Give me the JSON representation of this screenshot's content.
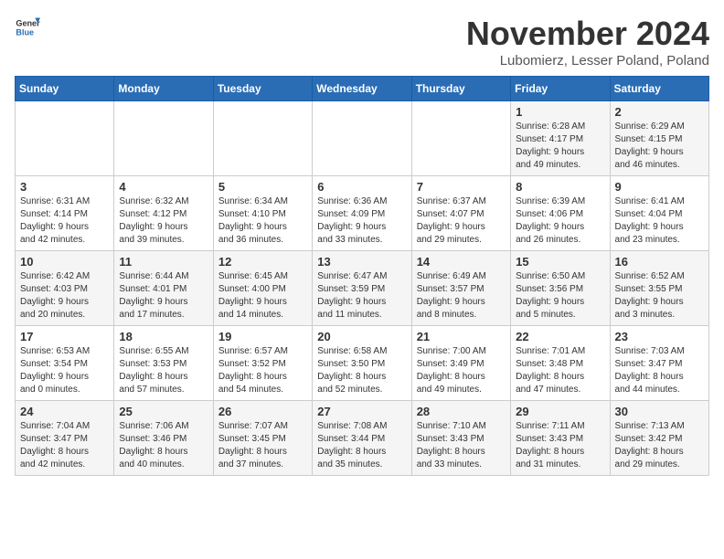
{
  "header": {
    "logo_general": "General",
    "logo_blue": "Blue",
    "month_title": "November 2024",
    "subtitle": "Lubomierz, Lesser Poland, Poland"
  },
  "weekdays": [
    "Sunday",
    "Monday",
    "Tuesday",
    "Wednesday",
    "Thursday",
    "Friday",
    "Saturday"
  ],
  "weeks": [
    [
      {
        "day": "",
        "info": ""
      },
      {
        "day": "",
        "info": ""
      },
      {
        "day": "",
        "info": ""
      },
      {
        "day": "",
        "info": ""
      },
      {
        "day": "",
        "info": ""
      },
      {
        "day": "1",
        "info": "Sunrise: 6:28 AM\nSunset: 4:17 PM\nDaylight: 9 hours\nand 49 minutes."
      },
      {
        "day": "2",
        "info": "Sunrise: 6:29 AM\nSunset: 4:15 PM\nDaylight: 9 hours\nand 46 minutes."
      }
    ],
    [
      {
        "day": "3",
        "info": "Sunrise: 6:31 AM\nSunset: 4:14 PM\nDaylight: 9 hours\nand 42 minutes."
      },
      {
        "day": "4",
        "info": "Sunrise: 6:32 AM\nSunset: 4:12 PM\nDaylight: 9 hours\nand 39 minutes."
      },
      {
        "day": "5",
        "info": "Sunrise: 6:34 AM\nSunset: 4:10 PM\nDaylight: 9 hours\nand 36 minutes."
      },
      {
        "day": "6",
        "info": "Sunrise: 6:36 AM\nSunset: 4:09 PM\nDaylight: 9 hours\nand 33 minutes."
      },
      {
        "day": "7",
        "info": "Sunrise: 6:37 AM\nSunset: 4:07 PM\nDaylight: 9 hours\nand 29 minutes."
      },
      {
        "day": "8",
        "info": "Sunrise: 6:39 AM\nSunset: 4:06 PM\nDaylight: 9 hours\nand 26 minutes."
      },
      {
        "day": "9",
        "info": "Sunrise: 6:41 AM\nSunset: 4:04 PM\nDaylight: 9 hours\nand 23 minutes."
      }
    ],
    [
      {
        "day": "10",
        "info": "Sunrise: 6:42 AM\nSunset: 4:03 PM\nDaylight: 9 hours\nand 20 minutes."
      },
      {
        "day": "11",
        "info": "Sunrise: 6:44 AM\nSunset: 4:01 PM\nDaylight: 9 hours\nand 17 minutes."
      },
      {
        "day": "12",
        "info": "Sunrise: 6:45 AM\nSunset: 4:00 PM\nDaylight: 9 hours\nand 14 minutes."
      },
      {
        "day": "13",
        "info": "Sunrise: 6:47 AM\nSunset: 3:59 PM\nDaylight: 9 hours\nand 11 minutes."
      },
      {
        "day": "14",
        "info": "Sunrise: 6:49 AM\nSunset: 3:57 PM\nDaylight: 9 hours\nand 8 minutes."
      },
      {
        "day": "15",
        "info": "Sunrise: 6:50 AM\nSunset: 3:56 PM\nDaylight: 9 hours\nand 5 minutes."
      },
      {
        "day": "16",
        "info": "Sunrise: 6:52 AM\nSunset: 3:55 PM\nDaylight: 9 hours\nand 3 minutes."
      }
    ],
    [
      {
        "day": "17",
        "info": "Sunrise: 6:53 AM\nSunset: 3:54 PM\nDaylight: 9 hours\nand 0 minutes."
      },
      {
        "day": "18",
        "info": "Sunrise: 6:55 AM\nSunset: 3:53 PM\nDaylight: 8 hours\nand 57 minutes."
      },
      {
        "day": "19",
        "info": "Sunrise: 6:57 AM\nSunset: 3:52 PM\nDaylight: 8 hours\nand 54 minutes."
      },
      {
        "day": "20",
        "info": "Sunrise: 6:58 AM\nSunset: 3:50 PM\nDaylight: 8 hours\nand 52 minutes."
      },
      {
        "day": "21",
        "info": "Sunrise: 7:00 AM\nSunset: 3:49 PM\nDaylight: 8 hours\nand 49 minutes."
      },
      {
        "day": "22",
        "info": "Sunrise: 7:01 AM\nSunset: 3:48 PM\nDaylight: 8 hours\nand 47 minutes."
      },
      {
        "day": "23",
        "info": "Sunrise: 7:03 AM\nSunset: 3:47 PM\nDaylight: 8 hours\nand 44 minutes."
      }
    ],
    [
      {
        "day": "24",
        "info": "Sunrise: 7:04 AM\nSunset: 3:47 PM\nDaylight: 8 hours\nand 42 minutes."
      },
      {
        "day": "25",
        "info": "Sunrise: 7:06 AM\nSunset: 3:46 PM\nDaylight: 8 hours\nand 40 minutes."
      },
      {
        "day": "26",
        "info": "Sunrise: 7:07 AM\nSunset: 3:45 PM\nDaylight: 8 hours\nand 37 minutes."
      },
      {
        "day": "27",
        "info": "Sunrise: 7:08 AM\nSunset: 3:44 PM\nDaylight: 8 hours\nand 35 minutes."
      },
      {
        "day": "28",
        "info": "Sunrise: 7:10 AM\nSunset: 3:43 PM\nDaylight: 8 hours\nand 33 minutes."
      },
      {
        "day": "29",
        "info": "Sunrise: 7:11 AM\nSunset: 3:43 PM\nDaylight: 8 hours\nand 31 minutes."
      },
      {
        "day": "30",
        "info": "Sunrise: 7:13 AM\nSunset: 3:42 PM\nDaylight: 8 hours\nand 29 minutes."
      }
    ]
  ]
}
